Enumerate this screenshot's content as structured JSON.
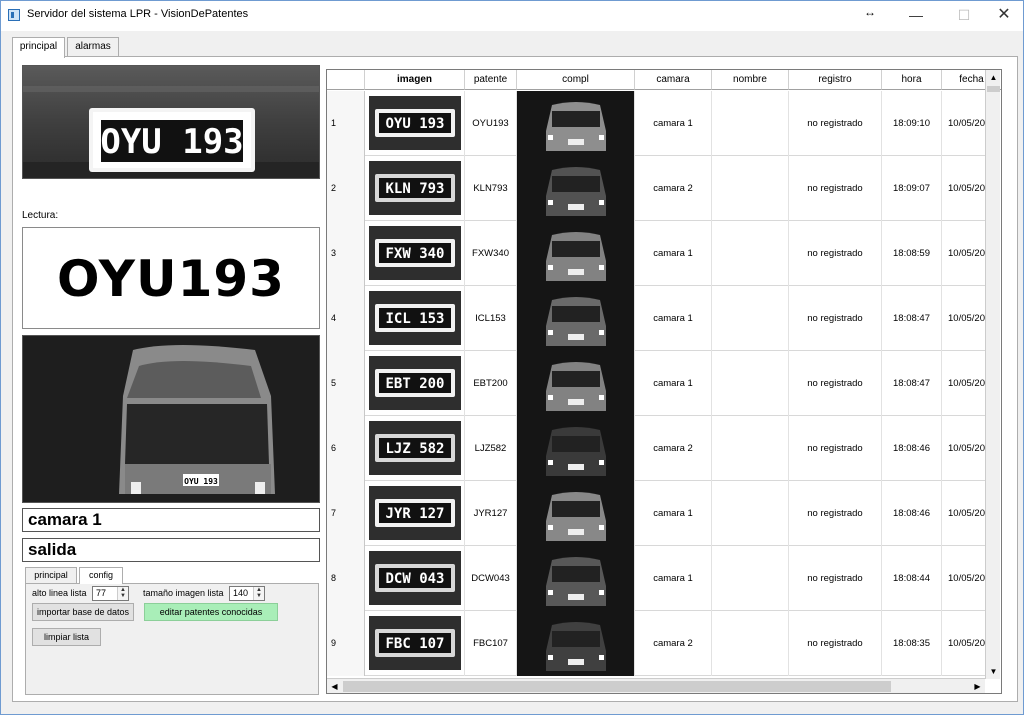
{
  "window": {
    "title": "Servidor del sistema LPR - VisionDePatentes",
    "minimize": "—",
    "maximize": "☐",
    "close": "✕",
    "cursor": "↔"
  },
  "tabs": [
    "principal",
    "alarmas"
  ],
  "left": {
    "plate_text": "OYU 193",
    "lectura_label": "Lectura:",
    "lectura_value": "OYU193",
    "car_plate": "OYU 193",
    "camera": "camara 1",
    "direction": "salida"
  },
  "subtabs": [
    "principal",
    "config"
  ],
  "config": {
    "alto_label": "alto linea lista",
    "alto_value": "77",
    "tamano_label": "tamaño imagen lista",
    "tamano_value": "140",
    "import_button": "importar base de datos",
    "edit_button": "editar patentes conocidas",
    "clear_button": "limpiar lista"
  },
  "table": {
    "columns": [
      "imagen",
      "patente",
      "compl",
      "camara",
      "nombre",
      "registro",
      "hora",
      "fecha"
    ],
    "rows": [
      {
        "n": "1",
        "plate_img": "OYU 193",
        "patente": "OYU193",
        "camara": "camara 1",
        "nombre": "",
        "registro": "no registrado",
        "hora": "18:09:10",
        "fecha": "10/05/20"
      },
      {
        "n": "2",
        "plate_img": "KLN 793",
        "patente": "KLN793",
        "camara": "camara 2",
        "nombre": "",
        "registro": "no registrado",
        "hora": "18:09:07",
        "fecha": "10/05/20"
      },
      {
        "n": "3",
        "plate_img": "FXW 340",
        "patente": "FXW340",
        "camara": "camara 1",
        "nombre": "",
        "registro": "no registrado",
        "hora": "18:08:59",
        "fecha": "10/05/20"
      },
      {
        "n": "4",
        "plate_img": "ICL 153",
        "patente": "ICL153",
        "camara": "camara 1",
        "nombre": "",
        "registro": "no registrado",
        "hora": "18:08:47",
        "fecha": "10/05/20"
      },
      {
        "n": "5",
        "plate_img": "EBT 200",
        "patente": "EBT200",
        "camara": "camara 1",
        "nombre": "",
        "registro": "no registrado",
        "hora": "18:08:47",
        "fecha": "10/05/20"
      },
      {
        "n": "6",
        "plate_img": "LJZ 582",
        "patente": "LJZ582",
        "camara": "camara 2",
        "nombre": "",
        "registro": "no registrado",
        "hora": "18:08:46",
        "fecha": "10/05/20"
      },
      {
        "n": "7",
        "plate_img": "JYR 127",
        "patente": "JYR127",
        "camara": "camara 1",
        "nombre": "",
        "registro": "no registrado",
        "hora": "18:08:46",
        "fecha": "10/05/20"
      },
      {
        "n": "8",
        "plate_img": "DCW 043",
        "patente": "DCW043",
        "camara": "camara 1",
        "nombre": "",
        "registro": "no registrado",
        "hora": "18:08:44",
        "fecha": "10/05/20"
      },
      {
        "n": "9",
        "plate_img": "FBC 107",
        "patente": "FBC107",
        "camara": "camara 2",
        "nombre": "",
        "registro": "no registrado",
        "hora": "18:08:35",
        "fecha": "10/05/20"
      }
    ]
  },
  "scroll": {
    "up": "▲",
    "down": "▼",
    "left": "◀",
    "right": "▶"
  }
}
